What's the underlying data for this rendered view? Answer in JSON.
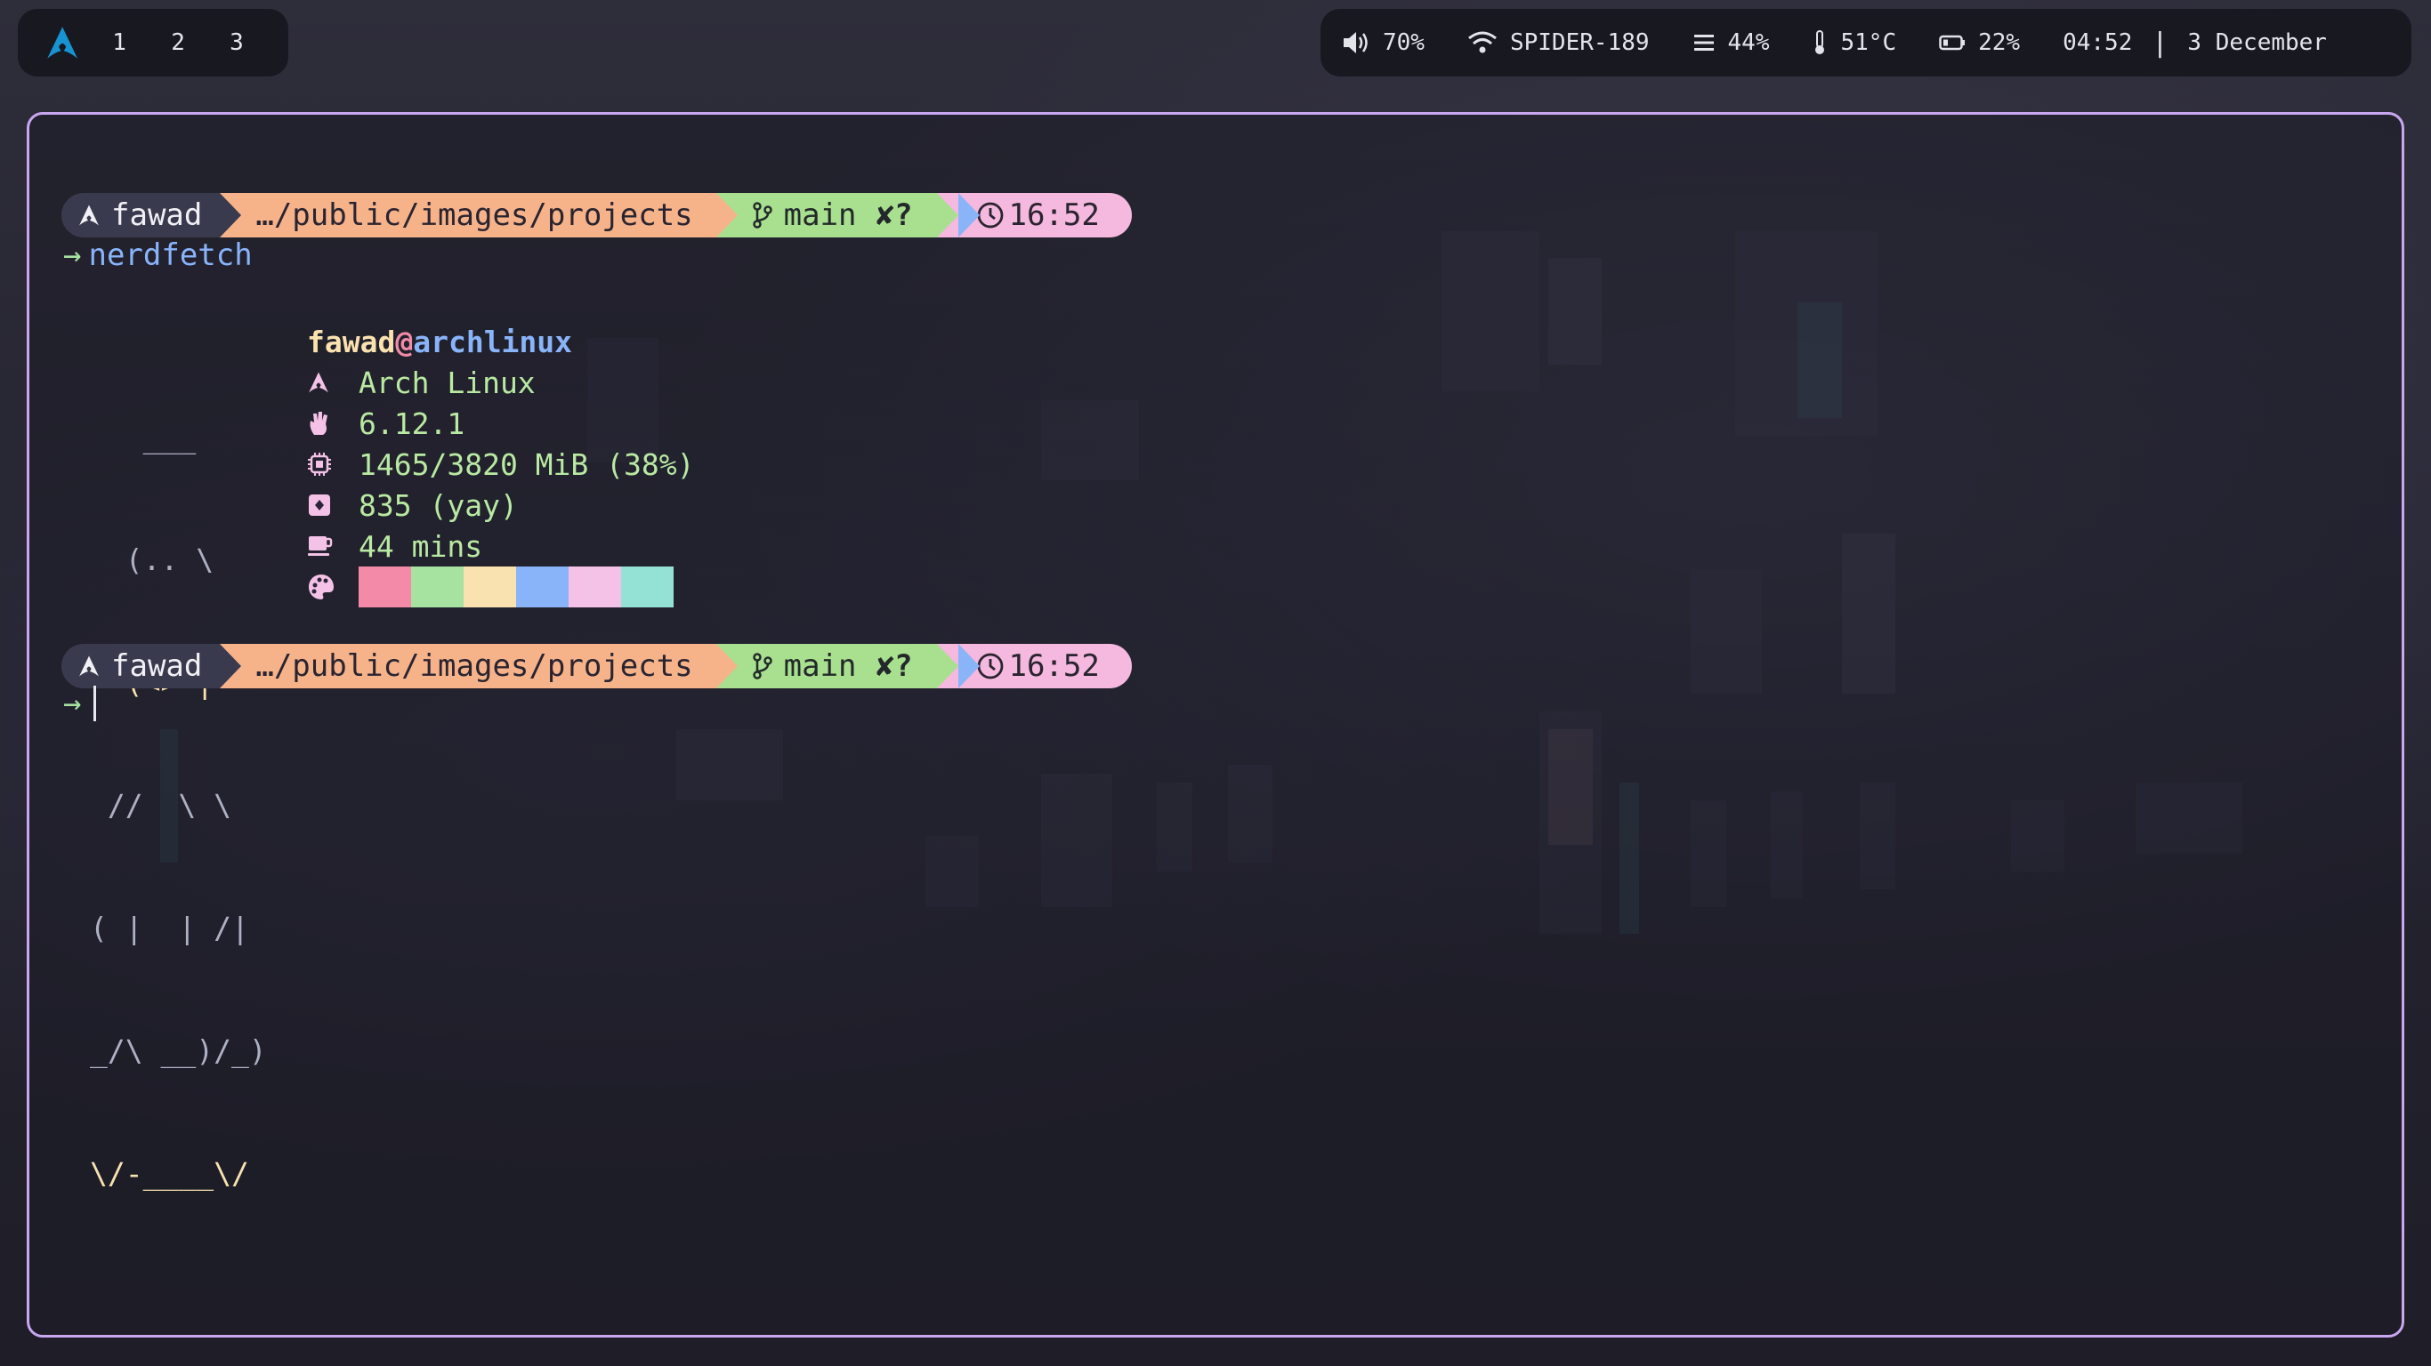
{
  "topbar": {
    "workspaces": [
      "1",
      "2",
      "3"
    ],
    "volume": "70%",
    "wifi": "SPIDER-189",
    "memory": "44%",
    "temperature": "51°C",
    "battery": "22%",
    "time": "04:52",
    "separator": "|",
    "date": "3 December"
  },
  "prompts": [
    {
      "user": "fawad",
      "path": "…/public/images/projects",
      "branch": "main",
      "git_status": "✘?",
      "time": "16:52",
      "arrow": "→",
      "command": "nerdfetch"
    },
    {
      "user": "fawad",
      "path": "…/public/images/projects",
      "branch": "main",
      "git_status": "✘?",
      "time": "16:52",
      "arrow": "→",
      "command": ""
    }
  ],
  "fetch": {
    "ascii_art": [
      "   ___",
      "  (.. \\",
      "  (<> |",
      " //  \\ \\",
      "( |  | /|",
      "_/\\ __)/_)",
      "\\/-____\\/"
    ],
    "user": "fawad",
    "at": "@",
    "host": "archlinux",
    "os": "Arch Linux",
    "kernel": "6.12.1",
    "memory": "1465/3820 MiB (38%)",
    "packages": "835 (yay)",
    "uptime": "44 mins",
    "palette": [
      "#f38ba8",
      "#a6e3a1",
      "#f9e2af",
      "#89b4fa",
      "#f5c2e7",
      "#94e2d5"
    ]
  },
  "colors": {
    "border": "#c9a7f0",
    "arch_blue": "#1793d1",
    "segment_user": "#3a3a4e",
    "segment_path": "#f6b38a",
    "segment_git": "#a8e08f",
    "segment_time": "#f5b8de"
  }
}
